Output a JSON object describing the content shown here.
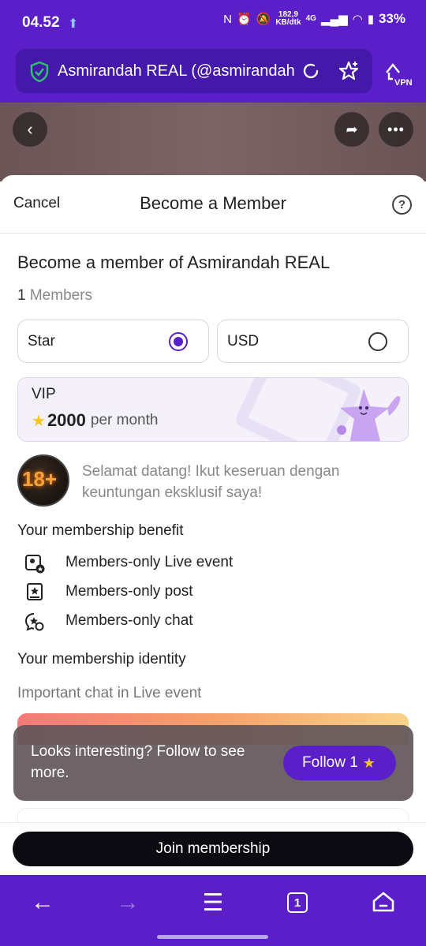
{
  "status_bar": {
    "time": "04.52",
    "net_speed_value": "182,9",
    "net_speed_unit": "KB/dtk",
    "network": "4G",
    "battery": "33%"
  },
  "browser": {
    "url_title": "Asmirandah REAL (@asmirandah",
    "vpn_label": "VPN"
  },
  "sheet": {
    "cancel_label": "Cancel",
    "title": "Become a Member",
    "heading": "Become a member of Asmirandah REAL",
    "member_count": "1",
    "member_count_label": "Members",
    "currency_options": [
      {
        "label": "Star",
        "selected": true
      },
      {
        "label": "USD",
        "selected": false
      }
    ],
    "tier": {
      "name": "VIP",
      "price": "2000",
      "period": "per month"
    },
    "avatar_text": "18+",
    "welcome_message": "Selamat datang! Ikut keseruan dengan keuntungan eksklusif saya!",
    "benefit_title": "Your membership benefit",
    "benefits": [
      {
        "label": "Members-only Live event",
        "icon": "live-event-icon"
      },
      {
        "label": "Members-only post",
        "icon": "post-icon"
      },
      {
        "label": "Members-only chat",
        "icon": "chat-icon"
      }
    ],
    "identity_title": "Your membership identity",
    "identity_subtitle": "Important chat in Live event"
  },
  "toast": {
    "message": "Looks interesting? Follow to see more.",
    "follow_label": "Follow 1"
  },
  "join_label": "Join membership",
  "bottom_nav": {
    "tab_count": "1"
  },
  "colors": {
    "brand_purple": "#5a1fc8",
    "join_button": "#0d0b12",
    "coin": "#f5c518"
  }
}
